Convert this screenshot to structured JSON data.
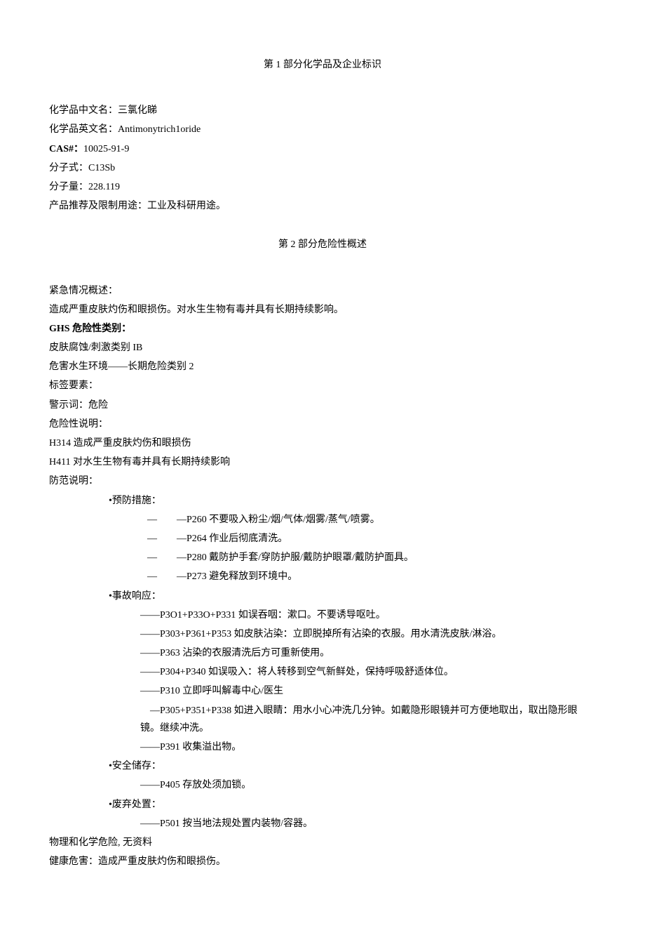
{
  "section1": {
    "title": "第 1 部分化学品及企业标识",
    "fields": {
      "name_cn_label": "化学品中文名：三氯化睇",
      "name_en_label": "化学品英文名：Antimonytrich1oride",
      "cas_label": "CAS#：",
      "cas_value": "10025-91-9",
      "formula_label": "分子式：C13Sb",
      "weight_label": "分子量：228.119",
      "usage_label": "产品推荐及限制用途：工业及科研用途。"
    }
  },
  "section2": {
    "title": "第 2 部分危险性概述",
    "emergency_label": "紧急情况概述：",
    "emergency_text": "造成严重皮肤灼伤和眼损伤。对水生生物有毒并具有长期持续影响。",
    "ghs_label": "GHS 危险性类别：",
    "ghs_line1": "皮肤腐蚀/刺激类别 IB",
    "ghs_line2": "危害水生环境——长期危险类别 2",
    "label_elements": "标签要素：",
    "signal_word": "警示词：危险",
    "hazard_statement_label": "危险性说明：",
    "h314": "H314 造成严重皮肤灼伤和眼损伤",
    "h411": "H411 对水生生物有毒并具有长期持续影响",
    "precaution_label": "防范说明：",
    "prevention": {
      "title": "•预防措施：",
      "items": [
        "—　　—P260 不要吸入粉尘/烟/气体/烟雾/蒸气/喷雾。",
        "—　　—P264 作业后彻底清洗。",
        "—　　—P280 戴防护手套/穿防护服/戴防护眼罩/戴防护面具。",
        "—　　—P273 避免释放到环境中。"
      ]
    },
    "response": {
      "title": "•事故响应：",
      "items": [
        "——P3O1+P33O+P331 如误吞咽：漱口。不要诱导呕吐。",
        "——P303+P361+P353 如皮肤沾染：立即脱掉所有沾染的衣服。用水清洗皮肤/淋浴。",
        "——P363 沾染的衣服清洗后方可重新使用。",
        "——P304+P340 如误吸入：将人转移到空气新鲜处，保持呼吸舒适体位。",
        "——P310 立即呼叫解毒中心/医生",
        "　—P305+P351+P338 如进入眼睛：用水小心冲洗几分钟。如戴隐形眼镜并可方便地取出，取出隐形眼镜。继续冲洗。",
        "——P391 收集溢出物。"
      ]
    },
    "storage": {
      "title": "•安全储存：",
      "items": [
        "——P405 存放处须加锁。"
      ]
    },
    "disposal": {
      "title": "•废弃处置：",
      "items": [
        "——P501 按当地法规处置内装物/容器。"
      ]
    },
    "physical_chemical": "物理和化学危险, 无资料",
    "health_hazard": "健康危害：造成严重皮肤灼伤和眼损伤。"
  }
}
